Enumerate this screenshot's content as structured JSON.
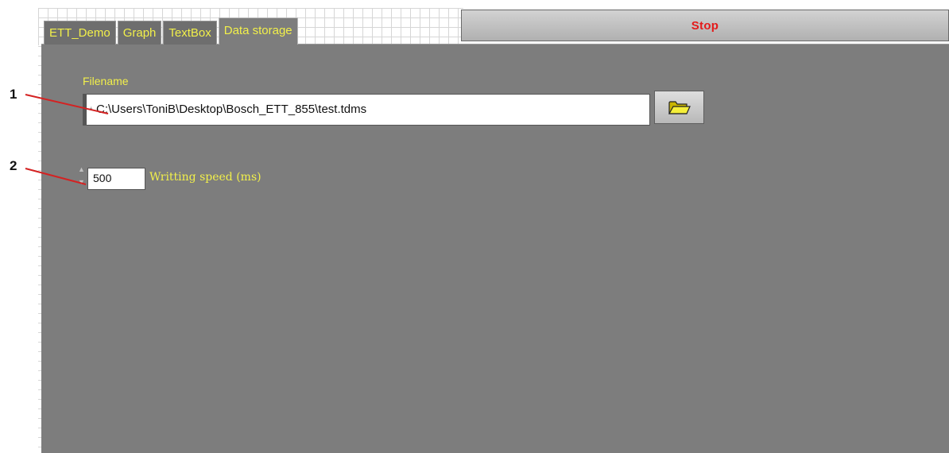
{
  "tabs": [
    {
      "label": "ETT_Demo",
      "active": false
    },
    {
      "label": "Graph",
      "active": false
    },
    {
      "label": "TextBox",
      "active": false
    },
    {
      "label": "Data storage",
      "active": true
    }
  ],
  "stop_button": {
    "label": "Stop",
    "color": "#e41b1b"
  },
  "file": {
    "label": "Filename",
    "value": "C:\\Users\\ToniB\\Desktop\\Bosch_ETT_855\\test.tdms",
    "browse_icon": "folder-open-icon"
  },
  "speed": {
    "value": "500",
    "label": "Writting speed (ms)"
  },
  "callouts": [
    {
      "number": "1"
    },
    {
      "number": "2"
    }
  ],
  "colors": {
    "panel": "#7d7d7d",
    "label_text": "#f2f04a",
    "callout_line": "#d42222"
  }
}
